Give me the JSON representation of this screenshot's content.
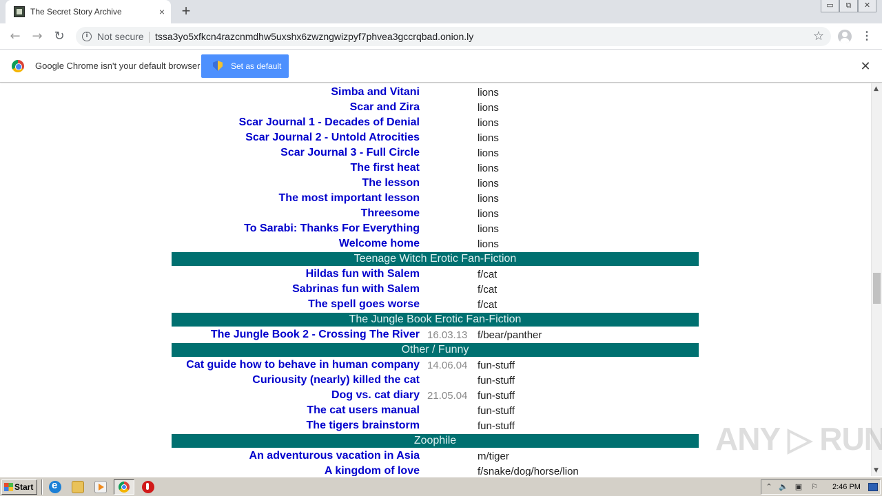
{
  "browser": {
    "tab_title": "The Secret Story Archive",
    "tab_close": "×",
    "new_tab": "+",
    "window_controls": [
      "▭",
      "⧉",
      "✕"
    ],
    "security_label": "Not secure",
    "url": "tssa3yo5xfkcn4razcnmdhw5uxshx6zwzngwizpyf7phvea3gccrqbad.onion.ly",
    "infobar_text": "Google Chrome isn't your default browser",
    "set_default_label": "Set as default",
    "infobar_close": "✕"
  },
  "page": {
    "rows": [
      {
        "kind": "story",
        "title": "Simba and Vitani",
        "date": "",
        "tag": "lions"
      },
      {
        "kind": "story",
        "title": "Scar and Zira",
        "date": "",
        "tag": "lions"
      },
      {
        "kind": "story",
        "title": "Scar Journal 1 - Decades of Denial",
        "date": "",
        "tag": "lions"
      },
      {
        "kind": "story",
        "title": "Scar Journal 2 - Untold Atrocities",
        "date": "",
        "tag": "lions"
      },
      {
        "kind": "story",
        "title": "Scar Journal 3 - Full Circle",
        "date": "",
        "tag": "lions"
      },
      {
        "kind": "story",
        "title": "The first heat",
        "date": "",
        "tag": "lions"
      },
      {
        "kind": "story",
        "title": "The lesson",
        "date": "",
        "tag": "lions"
      },
      {
        "kind": "story",
        "title": "The most important lesson",
        "date": "",
        "tag": "lions"
      },
      {
        "kind": "story",
        "title": "Threesome",
        "date": "",
        "tag": "lions"
      },
      {
        "kind": "story",
        "title": "To Sarabi: Thanks For Everything",
        "date": "",
        "tag": "lions"
      },
      {
        "kind": "story",
        "title": "Welcome home",
        "date": "",
        "tag": "lions"
      },
      {
        "kind": "section",
        "title": "Teenage Witch Erotic Fan-Fiction"
      },
      {
        "kind": "story",
        "title": "Hildas fun with Salem",
        "date": "",
        "tag": "f/cat"
      },
      {
        "kind": "story",
        "title": "Sabrinas fun with Salem",
        "date": "",
        "tag": "f/cat"
      },
      {
        "kind": "story",
        "title": "The spell goes worse",
        "date": "",
        "tag": "f/cat"
      },
      {
        "kind": "section",
        "title": "The Jungle Book Erotic Fan-Fiction"
      },
      {
        "kind": "story",
        "title": "The Jungle Book 2 - Crossing The River",
        "date": "16.03.13",
        "tag": "f/bear/panther"
      },
      {
        "kind": "section",
        "title": "Other / Funny"
      },
      {
        "kind": "story",
        "title": "Cat guide how to behave in human company",
        "date": "14.06.04",
        "tag": "fun-stuff"
      },
      {
        "kind": "story",
        "title": "Curiousity (nearly) killed the cat",
        "date": "",
        "tag": "fun-stuff"
      },
      {
        "kind": "story",
        "title": "Dog vs. cat diary",
        "date": "21.05.04",
        "tag": "fun-stuff"
      },
      {
        "kind": "story",
        "title": "The cat users manual",
        "date": "",
        "tag": "fun-stuff"
      },
      {
        "kind": "story",
        "title": "The tigers brainstorm",
        "date": "",
        "tag": "fun-stuff"
      },
      {
        "kind": "section",
        "title": "Zoophile"
      },
      {
        "kind": "story",
        "title": "An adventurous vacation in Asia",
        "date": "",
        "tag": "m/tiger"
      },
      {
        "kind": "story",
        "title": "A kingdom of love",
        "date": "",
        "tag": "f/snake/dog/horse/lion"
      }
    ]
  },
  "watermark": "ANY ▷ RUN",
  "taskbar": {
    "start_label": "Start",
    "clock": "2:46 PM",
    "tray_icons": [
      "⌃",
      "🔈",
      "▣",
      "⚐"
    ]
  },
  "colors": {
    "link": "#0000cc",
    "section_bg": "#007070",
    "date": "#8a8a8a"
  },
  "icons": [
    "tab-favicon",
    "info-icon",
    "star-icon",
    "profile-icon",
    "menu-icon",
    "chrome-logo",
    "shield-icon",
    "ie-icon",
    "folder-icon",
    "media-player-icon",
    "chrome-icon",
    "opera-icon"
  ]
}
